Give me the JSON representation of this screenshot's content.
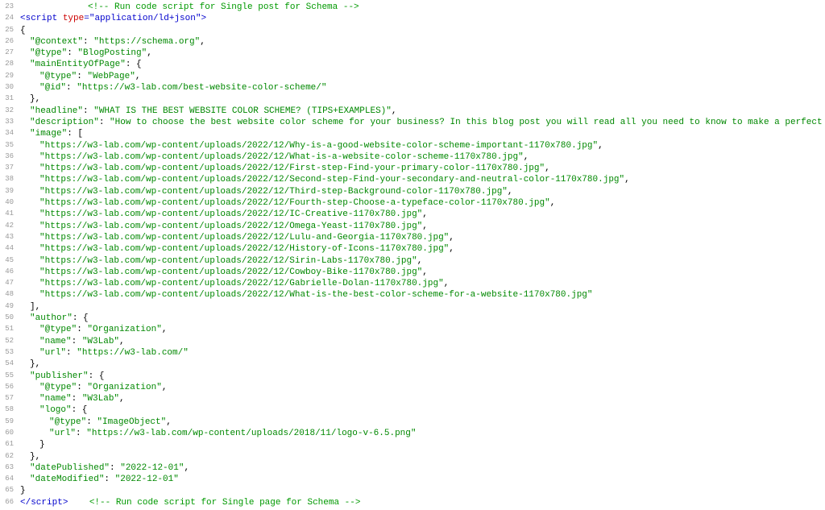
{
  "startLine": 23,
  "lines": [
    {
      "num": 23,
      "indent": 5,
      "type": "comment",
      "text": "<!-- Run code script for Single post for Schema -->"
    },
    {
      "num": 24,
      "indent": 0,
      "type": "opentag",
      "tag": "script",
      "attr": "type",
      "val": "application/ld+json"
    },
    {
      "num": 25,
      "indent": 0,
      "type": "punct",
      "text": "{"
    },
    {
      "num": 26,
      "indent": 1,
      "type": "kv",
      "key": "@context",
      "val": "https://schema.org",
      "comma": true
    },
    {
      "num": 27,
      "indent": 1,
      "type": "kv",
      "key": "@type",
      "val": "BlogPosting",
      "comma": true
    },
    {
      "num": 28,
      "indent": 1,
      "type": "kopen",
      "key": "mainEntityOfPage",
      "open": "{"
    },
    {
      "num": 29,
      "indent": 2,
      "type": "kv",
      "key": "@type",
      "val": "WebPage",
      "comma": true
    },
    {
      "num": 30,
      "indent": 2,
      "type": "kv",
      "key": "@id",
      "val": "https://w3-lab.com/best-website-color-scheme/",
      "comma": false
    },
    {
      "num": 31,
      "indent": 1,
      "type": "punct",
      "text": "},"
    },
    {
      "num": 32,
      "indent": 1,
      "type": "kv",
      "key": "headline",
      "val": "WHAT IS THE BEST WEBSITE COLOR SCHEME? (TIPS+EXAMPLES)",
      "comma": true
    },
    {
      "num": 33,
      "indent": 1,
      "type": "kv",
      "key": "description",
      "val": "How to choose the best website color scheme for your business? In this blog post you will read all you need to know to make a perfect choice.",
      "comma": true
    },
    {
      "num": 34,
      "indent": 1,
      "type": "kopen",
      "key": "image",
      "open": "["
    },
    {
      "num": 35,
      "indent": 2,
      "type": "str",
      "val": "https://w3-lab.com/wp-content/uploads/2022/12/Why-is-a-good-website-color-scheme-important-1170x780.jpg",
      "comma": true
    },
    {
      "num": 36,
      "indent": 2,
      "type": "str",
      "val": "https://w3-lab.com/wp-content/uploads/2022/12/What-is-a-website-color-scheme-1170x780.jpg",
      "comma": true
    },
    {
      "num": 37,
      "indent": 2,
      "type": "str",
      "val": "https://w3-lab.com/wp-content/uploads/2022/12/First-step-Find-your-primary-color-1170x780.jpg",
      "comma": true
    },
    {
      "num": 38,
      "indent": 2,
      "type": "str",
      "val": "https://w3-lab.com/wp-content/uploads/2022/12/Second-step-Find-your-secondary-and-neutral-color-1170x780.jpg",
      "comma": true
    },
    {
      "num": 39,
      "indent": 2,
      "type": "str",
      "val": "https://w3-lab.com/wp-content/uploads/2022/12/Third-step-Background-color-1170x780.jpg",
      "comma": true
    },
    {
      "num": 40,
      "indent": 2,
      "type": "str",
      "val": "https://w3-lab.com/wp-content/uploads/2022/12/Fourth-step-Choose-a-typeface-color-1170x780.jpg",
      "comma": true
    },
    {
      "num": 41,
      "indent": 2,
      "type": "str",
      "val": "https://w3-lab.com/wp-content/uploads/2022/12/IC-Creative-1170x780.jpg",
      "comma": true
    },
    {
      "num": 42,
      "indent": 2,
      "type": "str",
      "val": "https://w3-lab.com/wp-content/uploads/2022/12/Omega-Yeast-1170x780.jpg",
      "comma": true
    },
    {
      "num": 43,
      "indent": 2,
      "type": "str",
      "val": "https://w3-lab.com/wp-content/uploads/2022/12/Lulu-and-Georgia-1170x780.jpg",
      "comma": true
    },
    {
      "num": 44,
      "indent": 2,
      "type": "str",
      "val": "https://w3-lab.com/wp-content/uploads/2022/12/History-of-Icons-1170x780.jpg",
      "comma": true
    },
    {
      "num": 45,
      "indent": 2,
      "type": "str",
      "val": "https://w3-lab.com/wp-content/uploads/2022/12/Sirin-Labs-1170x780.jpg",
      "comma": true
    },
    {
      "num": 46,
      "indent": 2,
      "type": "str",
      "val": "https://w3-lab.com/wp-content/uploads/2022/12/Cowboy-Bike-1170x780.jpg",
      "comma": true
    },
    {
      "num": 47,
      "indent": 2,
      "type": "str",
      "val": "https://w3-lab.com/wp-content/uploads/2022/12/Gabrielle-Dolan-1170x780.jpg",
      "comma": true
    },
    {
      "num": 48,
      "indent": 2,
      "type": "str",
      "val": "https://w3-lab.com/wp-content/uploads/2022/12/What-is-the-best-color-scheme-for-a-website-1170x780.jpg",
      "comma": false
    },
    {
      "num": 49,
      "indent": 1,
      "type": "punct",
      "text": "],"
    },
    {
      "num": 50,
      "indent": 1,
      "type": "kopen",
      "key": "author",
      "open": "{"
    },
    {
      "num": 51,
      "indent": 2,
      "type": "kv",
      "key": "@type",
      "val": "Organization",
      "comma": true
    },
    {
      "num": 52,
      "indent": 2,
      "type": "kv",
      "key": "name",
      "val": "W3Lab",
      "comma": true
    },
    {
      "num": 53,
      "indent": 2,
      "type": "kv",
      "key": "url",
      "val": "https://w3-lab.com/",
      "comma": false
    },
    {
      "num": 54,
      "indent": 1,
      "type": "punct",
      "text": "},"
    },
    {
      "num": 55,
      "indent": 1,
      "type": "kopen",
      "key": "publisher",
      "open": "{"
    },
    {
      "num": 56,
      "indent": 2,
      "type": "kv",
      "key": "@type",
      "val": "Organization",
      "comma": true
    },
    {
      "num": 57,
      "indent": 2,
      "type": "kv",
      "key": "name",
      "val": "W3Lab",
      "comma": true
    },
    {
      "num": 58,
      "indent": 2,
      "type": "kopen",
      "key": "logo",
      "open": "{"
    },
    {
      "num": 59,
      "indent": 3,
      "type": "kv",
      "key": "@type",
      "val": "ImageObject",
      "comma": true
    },
    {
      "num": 60,
      "indent": 3,
      "type": "kv",
      "key": "url",
      "val": "https://w3-lab.com/wp-content/uploads/2018/11/logo-v-6.5.png",
      "comma": false
    },
    {
      "num": 61,
      "indent": 2,
      "type": "punct",
      "text": "}"
    },
    {
      "num": 62,
      "indent": 1,
      "type": "punct",
      "text": "},"
    },
    {
      "num": 63,
      "indent": 1,
      "type": "kv",
      "key": "datePublished",
      "val": "2022-12-01",
      "comma": true
    },
    {
      "num": 64,
      "indent": 1,
      "type": "kv",
      "key": "dateModified",
      "val": "2022-12-01",
      "comma": false
    },
    {
      "num": 65,
      "indent": 0,
      "type": "punct",
      "text": "}"
    },
    {
      "num": 66,
      "indent": 0,
      "type": "closetag",
      "tag": "script",
      "trailingComment": "<!-- Run code script for Single page for Schema -->"
    }
  ]
}
